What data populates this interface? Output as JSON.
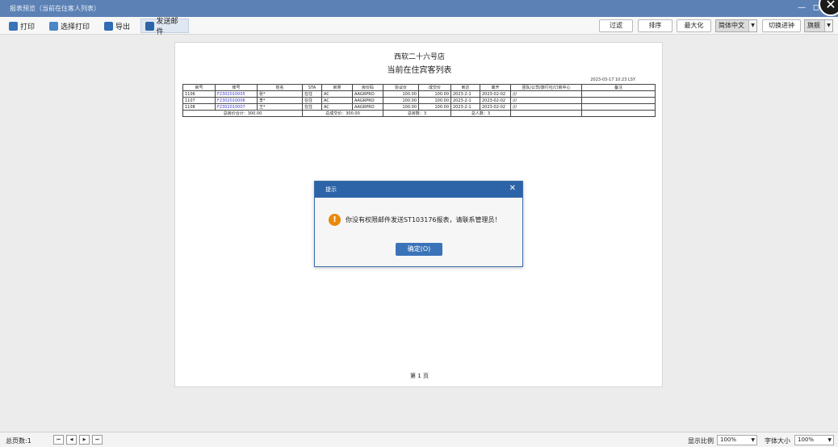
{
  "window": {
    "title": "报表预览（当前在住客人列表）",
    "minimize_glyph": "—",
    "restore_glyph": "◻",
    "close_glyph": "✕"
  },
  "toolbar": {
    "print_label": "打印",
    "select_print_label": "选择打印",
    "export_label": "导出",
    "send_mail_label": "发送邮件",
    "filter_label": "过滤",
    "sort_label": "排序",
    "maximize_label": "最大化",
    "language_select": "简体中文",
    "switch_label": "切换进钟",
    "font_select": "旗舰"
  },
  "report": {
    "hotel_name": "西软二十六号店",
    "title": "当前在住宾客列表",
    "timestamp": "2023-03-17 10:23  LSY",
    "columns": [
      "房号",
      "账号",
      "姓名",
      "STA",
      "房类",
      "房价码",
      "协议价",
      "成交价",
      "到达",
      "离开",
      "团队/公司/旅行社/订房中心",
      "备注"
    ],
    "rows": [
      [
        "1106",
        "F2302010005",
        "张*",
        "在住",
        "AC",
        "AAGRPRO",
        "100.00",
        "100.00",
        "2023-2-1",
        "2023-02-02",
        "///",
        ""
      ],
      [
        "1107",
        "F2302010006",
        "李*",
        "在住",
        "AC",
        "AAGRPRO",
        "100.00",
        "100.00",
        "2023-2-1",
        "2023-02-02",
        "///",
        ""
      ],
      [
        "1108",
        "F2302010007",
        "王*",
        "在住",
        "AC",
        "AAGRPRO",
        "100.00",
        "100.00",
        "2023-2-1",
        "2023-02-02",
        "///",
        ""
      ]
    ],
    "summary": {
      "rack_total": "总房价合计：300.00",
      "deal_total": "总成交价：300.00",
      "room_count": "总房数：3",
      "guest_count": "总人数：3"
    },
    "page_label": "第 1 页"
  },
  "dialog": {
    "title": "提示",
    "message": "你没有权限邮件发送ST103176报表，请联系管理员！",
    "ok_label": "确定(O)",
    "icon": "warning-icon"
  },
  "statusbar": {
    "total_pages": "总页数:1",
    "nav_first": "⏮",
    "nav_prev": "◀",
    "nav_next": "▶",
    "nav_last": "⏭",
    "zoom_label": "显示比例",
    "zoom_value": "100%",
    "font_size_label": "字体大小",
    "font_size_value": "100%"
  },
  "colors": {
    "titlebar": "#5b81b5",
    "dialog_header": "#2d64a8",
    "accent_button": "#3a73b8",
    "warning": "#e8890c",
    "link": "#3b3bd0"
  }
}
